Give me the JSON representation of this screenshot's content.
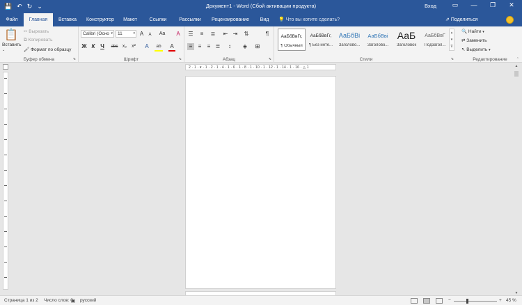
{
  "title_bar": {
    "title": "Документ1  -  Word (Сбой активации продукта)",
    "login": "Вход",
    "qat": {
      "save_icon": "floppy-icon",
      "undo_icon": "undo-icon",
      "redo_icon": "redo-icon",
      "more": "⌄"
    },
    "window": {
      "ribbon_options": "▭",
      "minimize": "—",
      "restore": "❐",
      "close": "✕"
    }
  },
  "tabs": [
    {
      "label": "Файл"
    },
    {
      "label": "Главная",
      "active": true
    },
    {
      "label": "Вставка"
    },
    {
      "label": "Конструктор"
    },
    {
      "label": "Макет"
    },
    {
      "label": "Ссылки"
    },
    {
      "label": "Рассылки"
    },
    {
      "label": "Рецензирование"
    },
    {
      "label": "Вид"
    }
  ],
  "tell_me": "Что вы хотите сделать?",
  "share": "Поделиться",
  "ribbon": {
    "clipboard": {
      "label": "Буфер обмена",
      "paste": "Вставить",
      "cut": "Вырезать",
      "copy": "Копировать",
      "format_painter": "Формат по образцу"
    },
    "font": {
      "label": "Шрифт",
      "font_name": "Calibri (Осно",
      "font_size": "11",
      "grow": "A",
      "shrink": "A",
      "case": "Aa",
      "clear": "A",
      "bold": "Ж",
      "italic": "К",
      "underline": "Ч",
      "strike": "abc",
      "subscript": "x₂",
      "superscript": "x²",
      "text_effects": "A",
      "highlight": "ab",
      "font_color": "A"
    },
    "paragraph": {
      "label": "Абзац",
      "pilcrow": "¶"
    },
    "styles": {
      "label": "Стили",
      "items": [
        {
          "sample": "АаБбВвГг,",
          "name": "¶ Обычный"
        },
        {
          "sample": "АаБбВвГг,",
          "name": "¶ Без инте..."
        },
        {
          "sample": "АаБбВі",
          "name": "Заголово..."
        },
        {
          "sample": "АаБбВві",
          "name": "Заголово..."
        },
        {
          "sample": "АаБ",
          "name": "Заголовок"
        },
        {
          "sample": "АаБбВвГ",
          "name": "Подзагол..."
        }
      ]
    },
    "editing": {
      "label": "Редактирование",
      "find": "Найти",
      "replace": "Заменить",
      "select": "Выделить"
    }
  },
  "ruler": {
    "numbers": "2 · 1 · ▾ · 1 · 2 · 1 · 4 · 1 · 6 · 1 · 8 · 1 · 10 · 1 · 12 · 1 · 14 · 1 · 16 · △ 1"
  },
  "status_bar": {
    "page": "Страница 1 из 2",
    "words": "Число слов: 0",
    "language": "русский",
    "zoom": "45 %",
    "zoom_minus": "−",
    "zoom_plus": "+"
  },
  "colors": {
    "accent": "#2b579a",
    "ribbon": "#f3f3f3",
    "workspace": "#e6e6e6"
  }
}
